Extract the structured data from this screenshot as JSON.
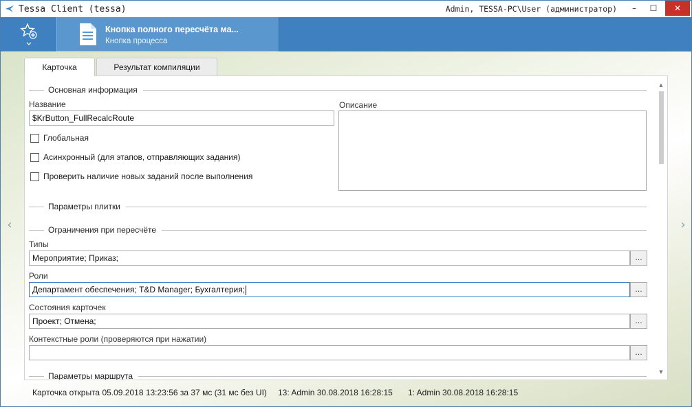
{
  "window": {
    "title": "Tessa Client (tessa)",
    "user": "Admin, TESSA-PC\\User (администратор)",
    "minimize": "–",
    "maximize": "☐",
    "close": "✕"
  },
  "header": {
    "card_title": "Кнопка полного пересчёта ма...",
    "card_subtitle": "Кнопка процесса"
  },
  "tabs": [
    {
      "label": "Карточка",
      "active": true
    },
    {
      "label": "Результат компиляции",
      "active": false
    }
  ],
  "form": {
    "section_main": "Основная информация",
    "name_label": "Название",
    "name_value": "$KrButton_FullRecalcRoute",
    "description_label": "Описание",
    "description_value": "",
    "checkboxes": [
      {
        "label": "Глобальная",
        "checked": false
      },
      {
        "label": "Асинхронный (для этапов, отправляющих задания)",
        "checked": false
      },
      {
        "label": "Проверить наличие новых заданий после выполнения",
        "checked": false
      }
    ],
    "section_tile": "Параметры плитки",
    "section_restrictions": "Ограничения при пересчёте",
    "types_label": "Типы",
    "types_value": "Мероприятие; Приказ;",
    "roles_label": "Роли",
    "roles_value": "Департамент обеспечения; T&D Manager; Бухгалтерия;",
    "states_label": "Состояния карточек",
    "states_value": "Проект; Отмена;",
    "context_roles_label": "Контекстные роли (проверяются при нажатии)",
    "context_roles_value": "",
    "ellipsis": "...",
    "section_route": "Параметры маршрута"
  },
  "status": {
    "opened": "Карточка открыта 05.09.2018 13:23:56 за 37 мс (31 мс без UI)",
    "version": "13:  Admin  30.08.2018 16:28:15",
    "created": "1:  Admin  30.08.2018 16:28:15"
  },
  "colors": {
    "header": "#3f81c0",
    "card_tab": "#5a97cf",
    "close_button": "#c7312a"
  }
}
